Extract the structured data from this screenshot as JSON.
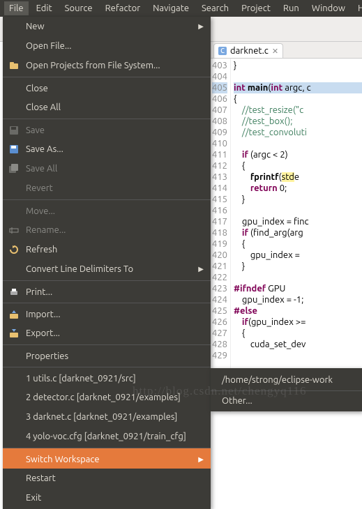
{
  "menubar": [
    "File",
    "Edit",
    "Source",
    "Refactor",
    "Navigate",
    "Search",
    "Project",
    "Run",
    "Window",
    "Help"
  ],
  "file_menu": {
    "new": "New",
    "open_file": "Open File...",
    "open_projects": "Open Projects from File System...",
    "close": "Close",
    "close_all": "Close All",
    "save": "Save",
    "save_as": "Save As...",
    "save_all": "Save All",
    "revert": "Revert",
    "move": "Move...",
    "rename": "Rename...",
    "refresh": "Refresh",
    "convert": "Convert Line Delimiters To",
    "print": "Print...",
    "import": "Import...",
    "export": "Export...",
    "properties": "Properties",
    "recent1": "1 utils.c  [darknet_0921/src]",
    "recent2": "2 detector.c  [darknet_0921/examples]",
    "recent3": "3 darknet.c  [darknet_0921/examples]",
    "recent4": "4 yolo-voc.cfg  [darknet_0921/train_cfg]",
    "switch_ws": "Switch Workspace",
    "restart": "Restart",
    "exit": "Exit"
  },
  "submenu": {
    "path": "/home/strong/eclipse-work",
    "other": "Other..."
  },
  "tab": {
    "name": "darknet.c"
  },
  "code_lines": [
    {
      "n": "403",
      "t": "}"
    },
    {
      "n": "404",
      "t": ""
    },
    {
      "n": "405",
      "html": "<span class='kw'>int</span> <b>main</b>(<span class='kw'>int</span> argc, c",
      "cls": "ln405"
    },
    {
      "n": "406",
      "t": "{"
    },
    {
      "n": "407",
      "html": "    <span class='cm'>//test_resize(\"c</span>"
    },
    {
      "n": "408",
      "html": "    <span class='cm'>//test_box();</span>"
    },
    {
      "n": "409",
      "html": "    <span class='cm'>//test_convoluti</span>"
    },
    {
      "n": "410",
      "t": ""
    },
    {
      "n": "411",
      "html": "    <span class='kw'>if</span> (argc &lt; 2)"
    },
    {
      "n": "412",
      "t": "    {"
    },
    {
      "n": "413",
      "html": "        <b>fprintf</b>(<span class='hl-yellow'>std</span>e"
    },
    {
      "n": "414",
      "html": "        <span class='kw'>return</span> 0;"
    },
    {
      "n": "415",
      "t": "    }"
    },
    {
      "n": "416",
      "t": ""
    },
    {
      "n": "417",
      "html": "    gpu_index = finc"
    },
    {
      "n": "418",
      "html": "    <span class='kw'>if</span> (find_arg(arg"
    },
    {
      "n": "419",
      "t": "    {"
    },
    {
      "n": "420",
      "html": "        gpu_index = "
    },
    {
      "n": "421",
      "t": "    }"
    },
    {
      "n": "422",
      "t": ""
    },
    {
      "n": "423",
      "html": "<span class='pp'>#ifndef</span> GPU"
    },
    {
      "n": "424",
      "html": "    gpu_index = -1;"
    },
    {
      "n": "425",
      "html": "<span class='pp'>#else</span>"
    },
    {
      "n": "426",
      "html": "    <span class='kw'>if</span>(gpu_index &gt;= "
    },
    {
      "n": "427",
      "t": "    {"
    },
    {
      "n": "428",
      "html": "        cuda_set_dev"
    },
    {
      "n": "429",
      "t": ""
    }
  ],
  "watermark": "http://blog.csdn.net/chengyq116"
}
